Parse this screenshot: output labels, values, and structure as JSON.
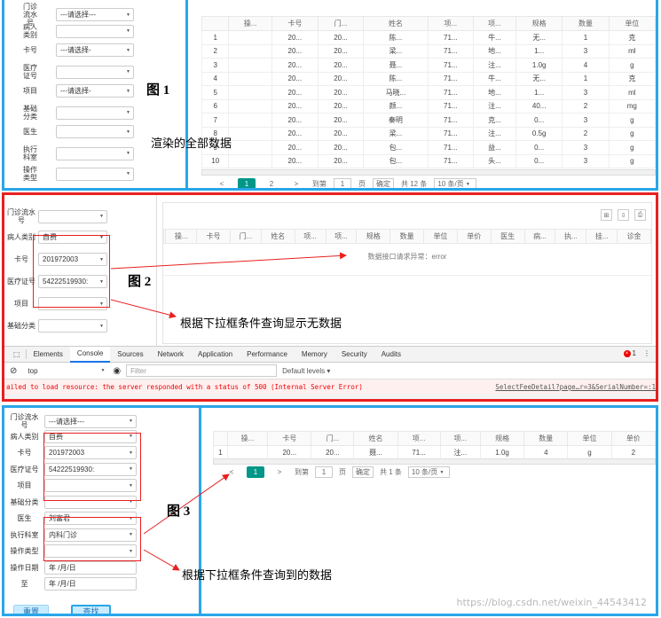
{
  "p1": {
    "sidebar": [
      {
        "label": "门诊\n流水\n号",
        "value": "---请选择---",
        "caret": true
      },
      {
        "label": "病人\n类别",
        "value": "",
        "caret": true
      },
      {
        "label": "卡号",
        "value": "---请选择-",
        "caret": true
      },
      {
        "label": "医疗\n证号",
        "value": "",
        "caret": true
      },
      {
        "label": "项目",
        "value": "---请选择-",
        "caret": true
      },
      {
        "label": "基础\n分类",
        "value": "",
        "caret": true
      },
      {
        "label": "医生",
        "value": "",
        "caret": true
      },
      {
        "label": "执行\n科室",
        "value": "",
        "caret": true
      },
      {
        "label": "操作\n类型",
        "value": "",
        "caret": true
      }
    ],
    "columns": [
      "",
      "操...",
      "卡号",
      "门...",
      "姓名",
      "项...",
      "项...",
      "规格",
      "数量",
      "单位"
    ],
    "rows": [
      [
        "1",
        "",
        "20...",
        "20...",
        "陈...",
        "71...",
        "牛...",
        "无...",
        "1",
        "克"
      ],
      [
        "2",
        "",
        "20...",
        "20...",
        "梁...",
        "71...",
        "地...",
        "1...",
        "3",
        "ml"
      ],
      [
        "3",
        "",
        "20...",
        "20...",
        "聂...",
        "71...",
        "注...",
        "1.0g",
        "4",
        "g"
      ],
      [
        "4",
        "",
        "20...",
        "20...",
        "陈...",
        "71...",
        "牛...",
        "无...",
        "1",
        "克"
      ],
      [
        "5",
        "",
        "20...",
        "20...",
        "马晓...",
        "71...",
        "地...",
        "1...",
        "3",
        "ml"
      ],
      [
        "6",
        "",
        "20...",
        "20...",
        "颜...",
        "71...",
        "注...",
        "40...",
        "2",
        "mg"
      ],
      [
        "7",
        "",
        "20...",
        "20...",
        "秦明",
        "71...",
        "克...",
        "0...",
        "3",
        "g"
      ],
      [
        "8",
        "",
        "20...",
        "20...",
        "梁...",
        "71...",
        "注...",
        "0.5g",
        "2",
        "g"
      ],
      [
        "9",
        "",
        "20...",
        "20...",
        "包...",
        "71...",
        "益...",
        "0...",
        "3",
        "g"
      ],
      [
        "10",
        "",
        "20...",
        "20...",
        "包...",
        "71...",
        "头...",
        "0...",
        "3",
        "g"
      ]
    ],
    "pager": {
      "prev": "<",
      "page1": "1",
      "page2": "2",
      "next": ">",
      "goto": "到第",
      "page_input": "1",
      "page_unit": "页",
      "confirm": "确定",
      "total": "共 12 条",
      "per_page": "10 条/页"
    },
    "fig": "图 1",
    "note": "渲染的全部数据"
  },
  "p2": {
    "sidebar": [
      {
        "label": "门诊流水\n号",
        "value": "",
        "caret": true
      },
      {
        "label": "病人类别",
        "value": "自费",
        "caret": true
      },
      {
        "label": "卡号",
        "value": "201972003",
        "caret": true
      },
      {
        "label": "医疗证号",
        "value": "54222519930:",
        "caret": true
      },
      {
        "label": "项目",
        "value": "",
        "caret": true
      },
      {
        "label": "基础分类",
        "value": "",
        "caret": true
      }
    ],
    "toolbar_icons": [
      "⊞",
      "⇩",
      "⎙"
    ],
    "columns": [
      "",
      "操...",
      "卡号",
      "门...",
      "姓名",
      "项...",
      "项...",
      "规格",
      "数量",
      "单位",
      "单价",
      "医生",
      "病...",
      "执...",
      "挂...",
      "诊金"
    ],
    "empty_msg": "数据接口请求异常：error",
    "fig": "图 2",
    "note": "根据下拉框条件查询显示无数据",
    "devtools": {
      "tabs": [
        "Elements",
        "Console",
        "Sources",
        "Network",
        "Application",
        "Performance",
        "Memory",
        "Security",
        "Audits"
      ],
      "active": "Console",
      "context": "top",
      "filter_placeholder": "Filter",
      "levels": "Default levels ▾",
      "error_count": "1",
      "error_msg": "ailed to load resource: the server responded with a status of 500 (Internal Server Error)",
      "error_link": "SelectFeeDetail?page…r=3&SerialNumber=:1"
    }
  },
  "p3": {
    "sidebar": [
      {
        "label": "门诊流水\n号",
        "value": "---请选择---",
        "caret": true
      },
      {
        "label": "病人类别",
        "value": "自费",
        "caret": true
      },
      {
        "label": "卡号",
        "value": "201972003",
        "caret": true
      },
      {
        "label": "医疗证号",
        "value": "54222519930:",
        "caret": true
      },
      {
        "label": "项目",
        "value": "",
        "caret": true
      },
      {
        "label": "基础分类",
        "value": "",
        "caret": true
      },
      {
        "label": "医生",
        "value": "刘富君",
        "caret": true
      },
      {
        "label": "执行科室",
        "value": "内科门诊",
        "caret": true
      },
      {
        "label": "操作类型",
        "value": "",
        "caret": true
      },
      {
        "label": "操作日期",
        "value": "年 /月/日",
        "caret": false
      },
      {
        "label": "至",
        "value": "年 /月/日",
        "caret": false
      }
    ],
    "columns": [
      "",
      "操...",
      "卡号",
      "门...",
      "姓名",
      "项...",
      "项...",
      "规格",
      "数量",
      "单位",
      "单价"
    ],
    "rows": [
      [
        "1",
        "",
        "20...",
        "20...",
        "聂...",
        "71...",
        "注...",
        "1.0g",
        "4",
        "g",
        "2"
      ]
    ],
    "pager": {
      "prev": "<",
      "page1": "1",
      "next": ">",
      "goto": "到第",
      "page_input": "1",
      "page_unit": "页",
      "confirm": "确定",
      "total": "共 1 条",
      "per_page": "10 条/页"
    },
    "reset": "重置",
    "search": "查找",
    "fig": "图 3",
    "note": "根据下拉框条件查询到的数据"
  },
  "watermark": "https://blog.csdn.net/weixin_44543412"
}
